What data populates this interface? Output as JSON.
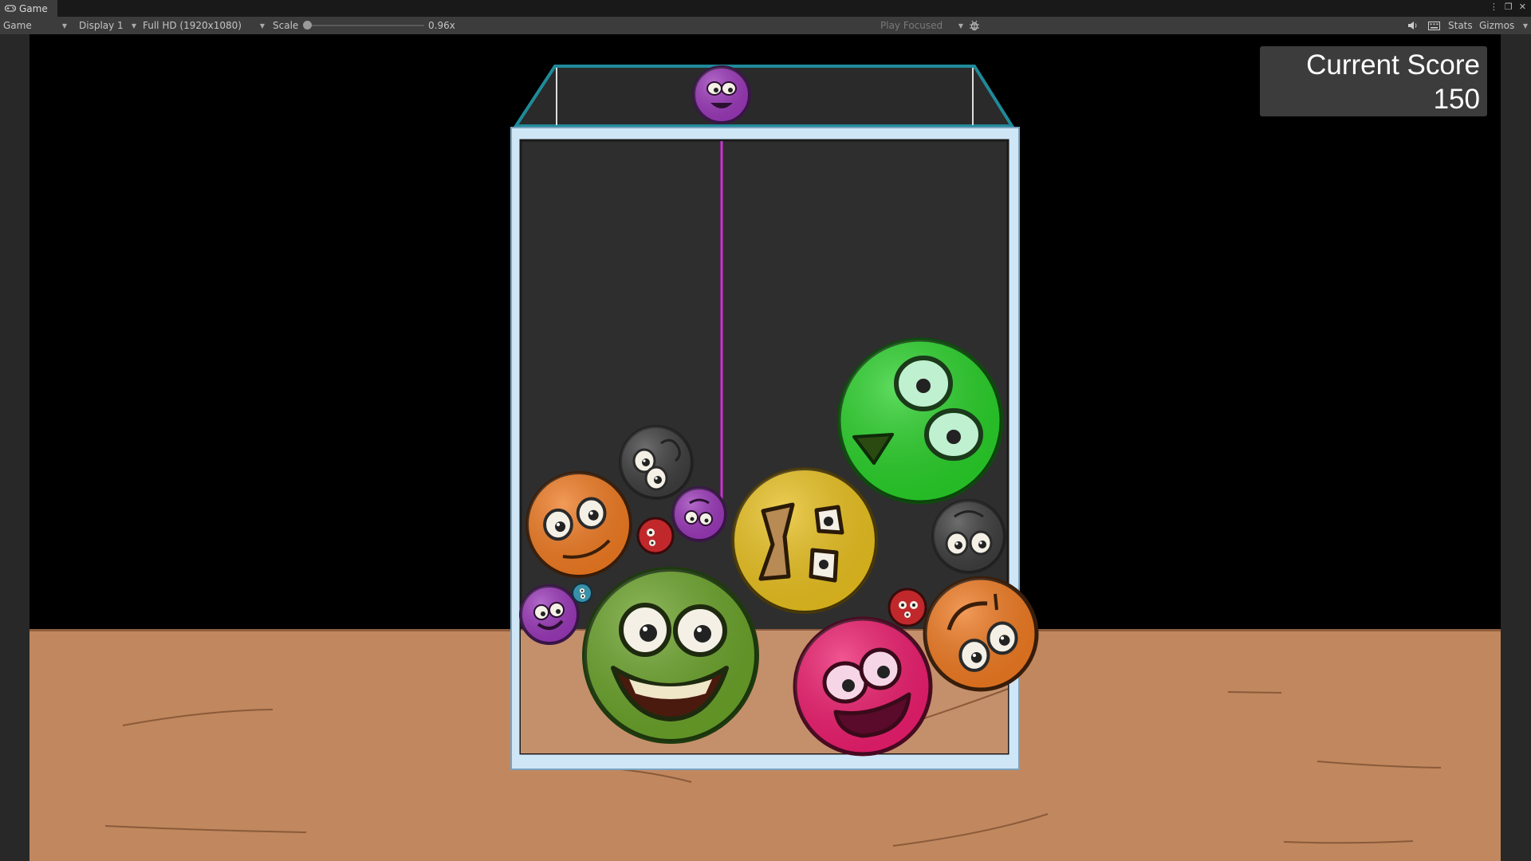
{
  "editor": {
    "tab_title": "Game",
    "toolbar": {
      "view_mode": "Game",
      "display": "Display 1",
      "resolution": "Full HD (1920x1080)",
      "scale_label": "Scale",
      "scale_value": "0.96x",
      "play_mode": "Play Focused",
      "stats_label": "Stats",
      "gizmos_label": "Gizmos"
    },
    "icons": [
      "gamepad-icon",
      "more-options-icon",
      "maximize-icon",
      "close-icon",
      "bug-icon",
      "audio-icon",
      "keyboard-icon"
    ]
  },
  "game": {
    "score_label": "Current Score",
    "score_value": "150",
    "next_ball": "purple",
    "balls": [
      {
        "color": "purple",
        "face": "small-grin"
      },
      {
        "color": "gray",
        "face": "scribble"
      },
      {
        "color": "orange",
        "face": "smile"
      },
      {
        "color": "red",
        "face": "dots"
      },
      {
        "color": "purple",
        "face": "small-grin"
      },
      {
        "color": "yellow",
        "face": "googly"
      },
      {
        "color": "green",
        "face": "cyclops-eyes"
      },
      {
        "color": "gray",
        "face": "scribble"
      },
      {
        "color": "purple",
        "face": "small-grin"
      },
      {
        "color": "teal",
        "face": "dots"
      },
      {
        "color": "olive",
        "face": "big-grin"
      },
      {
        "color": "pink",
        "face": "open-mouth"
      },
      {
        "color": "red",
        "face": "dots"
      },
      {
        "color": "orange",
        "face": "frown"
      }
    ],
    "colors": {
      "green": "#2ad02a",
      "olive": "#6aa22a",
      "orange": "#ee7a22",
      "yellow": "#e8c020",
      "pink": "#ec1e6e",
      "purple": "#9a38b8",
      "red": "#c0282c",
      "gray": "#3e3e3e",
      "teal": "#3a8fa8",
      "aim_line": "#d030d8",
      "container_frame": "#cfe6f6",
      "container_inner": "#2e2e2e",
      "floor": "#c1875e",
      "top_rim": "#1f8a9a"
    }
  }
}
